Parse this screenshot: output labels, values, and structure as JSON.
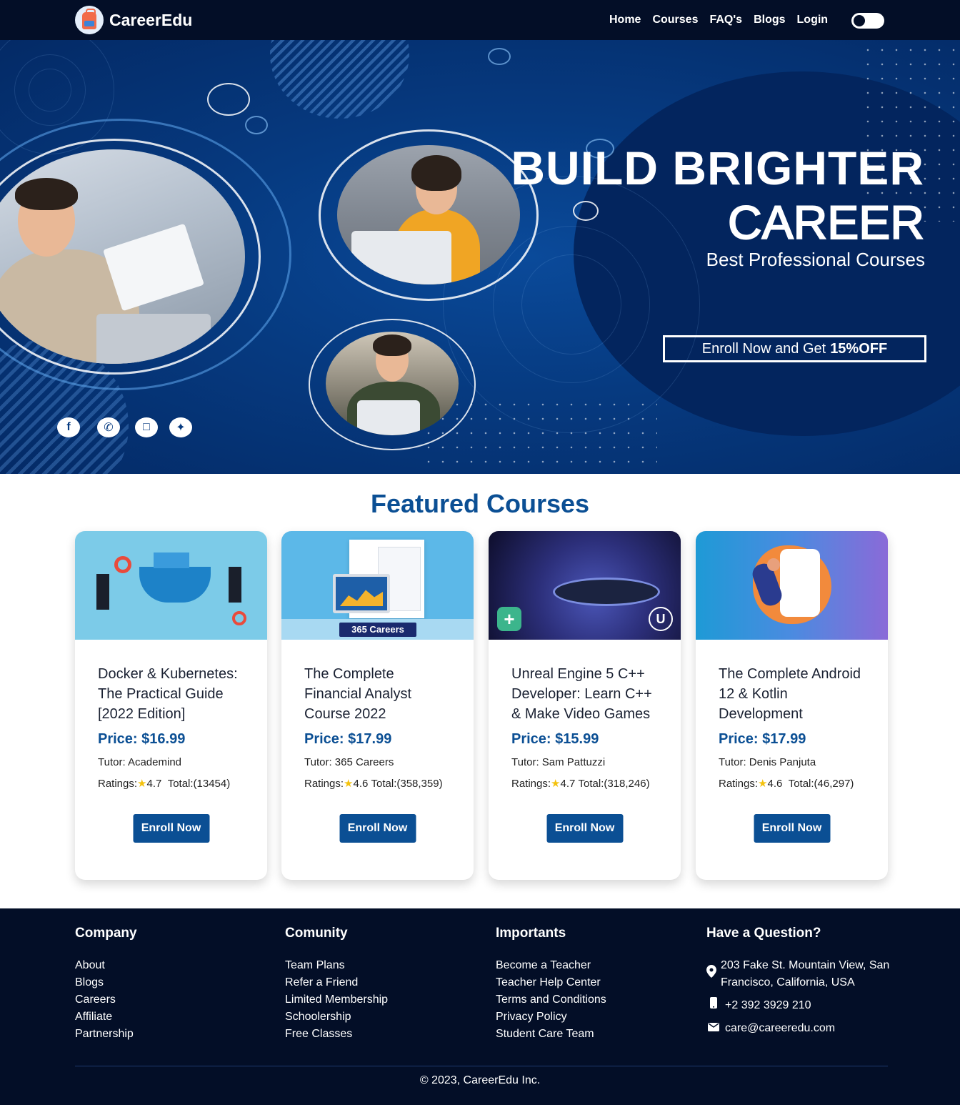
{
  "brand": {
    "name": "CareerEdu",
    "icon": "school-bag-logo-icon"
  },
  "nav": {
    "links": [
      "Home",
      "Courses",
      "FAQ's",
      "Blogs",
      "Login"
    ],
    "theme_toggle": "dark-mode-toggle"
  },
  "hero": {
    "title_line1": "BUILD BRIGHTER",
    "title_line2": "CAREER",
    "subtitle": "Best Professional Courses",
    "cta_text": "Enroll Now and Get",
    "cta_bold": "15%OFF",
    "social_icons": [
      "facebook-icon",
      "whatsapp-icon",
      "instagram-icon",
      "twitter-icon"
    ]
  },
  "featured": {
    "heading": "Featured Courses",
    "courses": [
      {
        "title": "Docker & Kubernetes: The Practical Guide [2022 Edition]",
        "price": "Price: $16.99",
        "tutor": "Tutor: Academind",
        "ratings_label": "Ratings:",
        "rating": "4.7",
        "total": "Total:(13454)",
        "button": "Enroll Now"
      },
      {
        "title": "The Complete Financial Analyst Course 2022",
        "price": "Price: $17.99",
        "tutor": "Tutor: 365 Careers",
        "ratings_label": "Ratings:",
        "rating": "4.6",
        "total": "Total:(358,359)",
        "button": "Enroll Now",
        "image_caption": "365 Careers"
      },
      {
        "title": "Unreal Engine 5 C++ Developer: Learn C++ & Make Video Games",
        "price": "Price: $15.99",
        "tutor": "Tutor: Sam Pattuzzi",
        "ratings_label": "Ratings:",
        "rating": "4.7",
        "total": "Total:(318,246)",
        "button": "Enroll Now"
      },
      {
        "title": "The Complete Android 12 & Kotlin Development",
        "price": "Price: $17.99",
        "tutor": "Tutor: Denis Panjuta",
        "ratings_label": "Ratings:",
        "rating": "4.6",
        "total": "Total:(46,297)",
        "button": "Enroll Now"
      }
    ]
  },
  "footer": {
    "company": {
      "heading": "Company",
      "links": [
        "About",
        "Blogs",
        "Careers",
        "Affiliate",
        "Partnership"
      ]
    },
    "community": {
      "heading": "Comunity",
      "links": [
        "Team Plans",
        "Refer a Friend",
        "Limited Membership",
        "Schoolership",
        "Free Classes"
      ]
    },
    "importants": {
      "heading": "Importants",
      "links": [
        "Become a Teacher",
        "Teacher Help Center",
        "Terms and Conditions",
        "Privacy Policy",
        "Student Care Team"
      ]
    },
    "contact": {
      "heading": "Have a Question?",
      "address": "203 Fake St. Mountain View, San Francisco, California, USA",
      "phone": "+2 392 3929 210",
      "email": "care@careeredu.com"
    },
    "copyright": "© 2023, CareerEdu Inc."
  },
  "colors": {
    "nav_bg": "#030e27",
    "hero_bg": "#063a80",
    "accent": "#0b4f94",
    "star": "#f4c20d"
  }
}
